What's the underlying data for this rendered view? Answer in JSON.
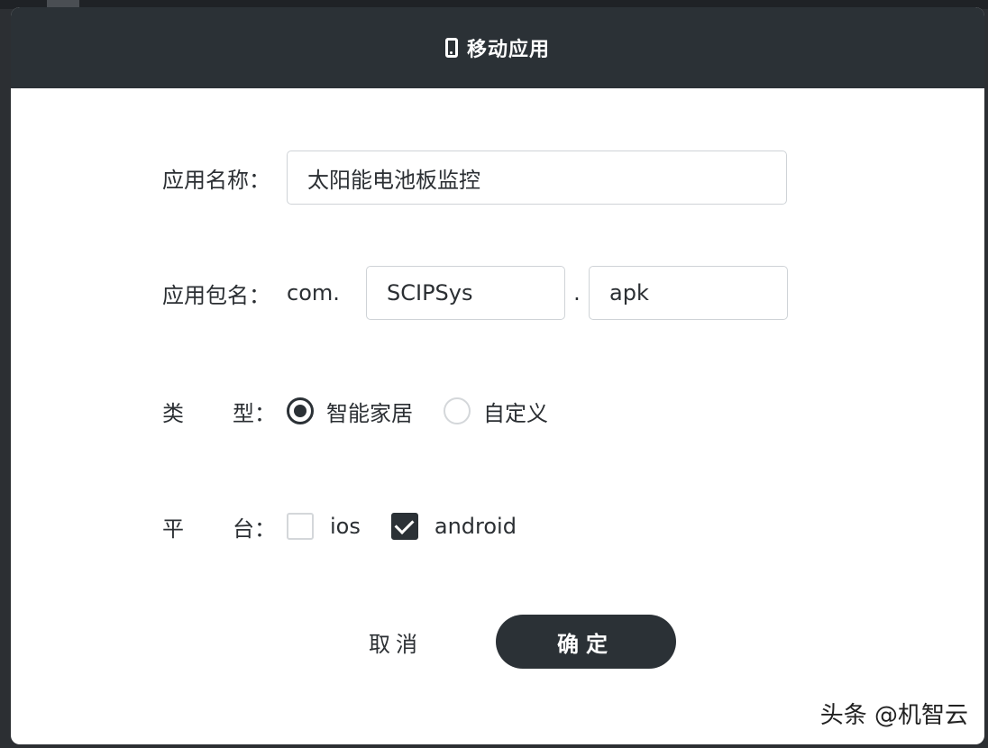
{
  "dialog": {
    "title": "移动应用",
    "icon": "phone-icon"
  },
  "form": {
    "app_name": {
      "label": "应用名称：",
      "value": "太阳能电池板监控"
    },
    "package": {
      "label": "应用包名：",
      "prefix": "com.",
      "segment1": "SCIPSys",
      "separator": ".",
      "segment2": "apk"
    },
    "type": {
      "label_a": "类",
      "label_b": "型：",
      "options": [
        {
          "label": "智能家居",
          "selected": true
        },
        {
          "label": "自定义",
          "selected": false
        }
      ]
    },
    "platform": {
      "label_a": "平",
      "label_b": "台：",
      "options": [
        {
          "label": "ios",
          "checked": false
        },
        {
          "label": "android",
          "checked": true
        }
      ]
    }
  },
  "buttons": {
    "cancel": "取消",
    "ok": "确定"
  },
  "watermark": "头条 @机智云",
  "colors": {
    "header_bg": "#2b3136",
    "primary": "#2b3136",
    "border": "#cfd3d7"
  }
}
